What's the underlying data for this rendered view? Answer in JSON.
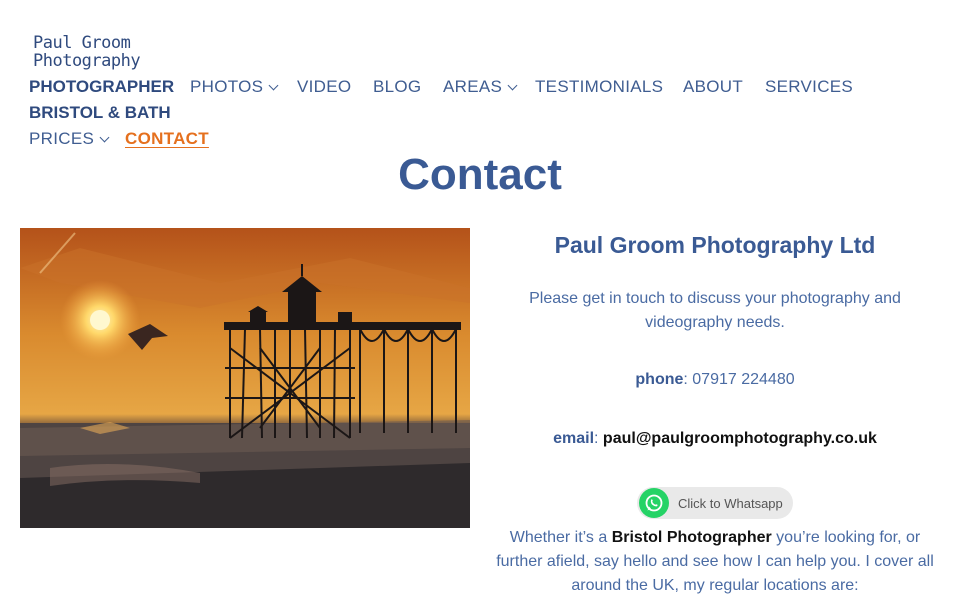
{
  "site": {
    "logo_line1": "Paul Groom",
    "logo_line2": "Photography",
    "brand_line1": "PHOTOGRAPHER",
    "brand_line2": "BRISTOL & BATH"
  },
  "nav": {
    "photos": "PHOTOS",
    "video": "VIDEO",
    "blog": "BLOG",
    "areas": "AREAS",
    "testimonials": "TESTIMONIALS",
    "about": "ABOUT",
    "services": "SERVICES",
    "prices": "PRICES",
    "contact": "CONTACT"
  },
  "page": {
    "title": "Contact"
  },
  "contact": {
    "company": "Paul Groom Photography Ltd",
    "intro": "Please get in touch to discuss your photography and videography needs.",
    "phone_label": "phone",
    "phone_value": ": 07917 224480",
    "email_label": "email",
    "email_sep": ": ",
    "email_value": "paul@paulgroomphotography.co.uk",
    "whatsapp_label": "Click to Whatsapp",
    "bottom_pre": "Whether it’s a ",
    "bottom_bold": "Bristol Photographer",
    "bottom_post": " you’re looking for, or further afield, say hello and see how I can help you. I cover all around the UK, my regular locations are:"
  },
  "colors": {
    "brand_blue": "#2f4a7e",
    "nav_blue": "#3f5d91",
    "accent_orange": "#e5701e",
    "whatsapp_green": "#25d366"
  },
  "icons": {
    "whatsapp": "whatsapp-icon",
    "dropdown": "chevron-down-icon"
  }
}
